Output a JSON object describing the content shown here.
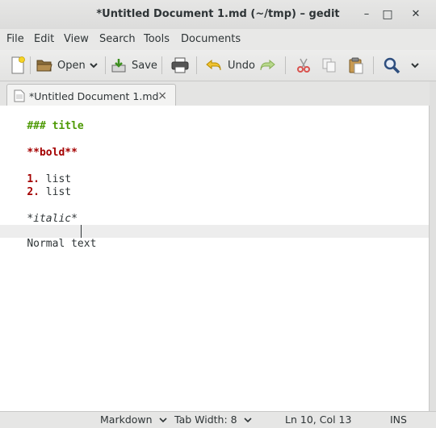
{
  "window": {
    "title": "*Untitled Document 1.md (~/tmp) – gedit",
    "minimize_glyph": "–",
    "maximize_glyph": "□",
    "close_glyph": "✕"
  },
  "menubar": {
    "items": [
      "File",
      "Edit",
      "View",
      "Search",
      "Tools",
      "Documents"
    ]
  },
  "toolbar": {
    "open_label": "Open",
    "save_label": "Save",
    "undo_label": "Undo"
  },
  "tabs": [
    {
      "label": "*Untitled Document 1.md",
      "close_glyph": "×"
    }
  ],
  "editor": {
    "lines": [
      "### title",
      "",
      "**bold**",
      "",
      "1. list",
      "2. list",
      "",
      "*italic*",
      "",
      "Normal text"
    ],
    "colors": {
      "heading": "#4e9a06",
      "bold": "#a40000",
      "list_marker": "#a40000",
      "text": "#2e3436"
    }
  },
  "statusbar": {
    "language": "Markdown",
    "tab_width": "Tab Width: 8",
    "position": "Ln 10, Col 13",
    "mode": "INS"
  },
  "icons": [
    "new-document-icon",
    "open-folder-icon",
    "save-icon",
    "print-icon",
    "undo-icon",
    "redo-icon",
    "cut-icon",
    "copy-icon",
    "paste-icon",
    "search-icon"
  ]
}
